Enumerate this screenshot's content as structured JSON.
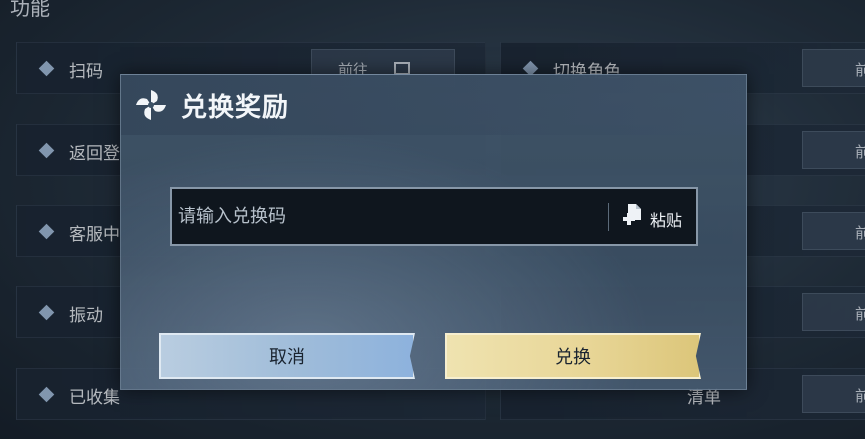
{
  "background": {
    "section_title": "功能",
    "left_rows": [
      {
        "label": "扫码",
        "action": "前往"
      },
      {
        "label": "返回登",
        "action": ""
      },
      {
        "label": "客服中",
        "action": ""
      },
      {
        "label": "振动",
        "action": ""
      },
      {
        "label": "已收集",
        "action": ""
      }
    ],
    "right_rows": [
      {
        "label": "切换角色",
        "action": "前"
      },
      {
        "label": "",
        "action": "前"
      },
      {
        "label": "",
        "action": "前"
      },
      {
        "label": "",
        "action": "前"
      },
      {
        "label": "清单",
        "action": "前"
      }
    ]
  },
  "dialog": {
    "title": "兑换奖励",
    "input_placeholder": "请输入兑换码",
    "input_value": "",
    "paste_label": "粘贴",
    "cancel_label": "取消",
    "exchange_label": "兑换"
  },
  "colors": {
    "cancel_button": "#9fbcd9",
    "exchange_button": "#e8d697",
    "input_bg": "#0f161e"
  },
  "icons": {
    "dialog_icon": "pinwheel-icon",
    "paste_icon": "paste-icon",
    "row_marker": "diamond-icon"
  }
}
